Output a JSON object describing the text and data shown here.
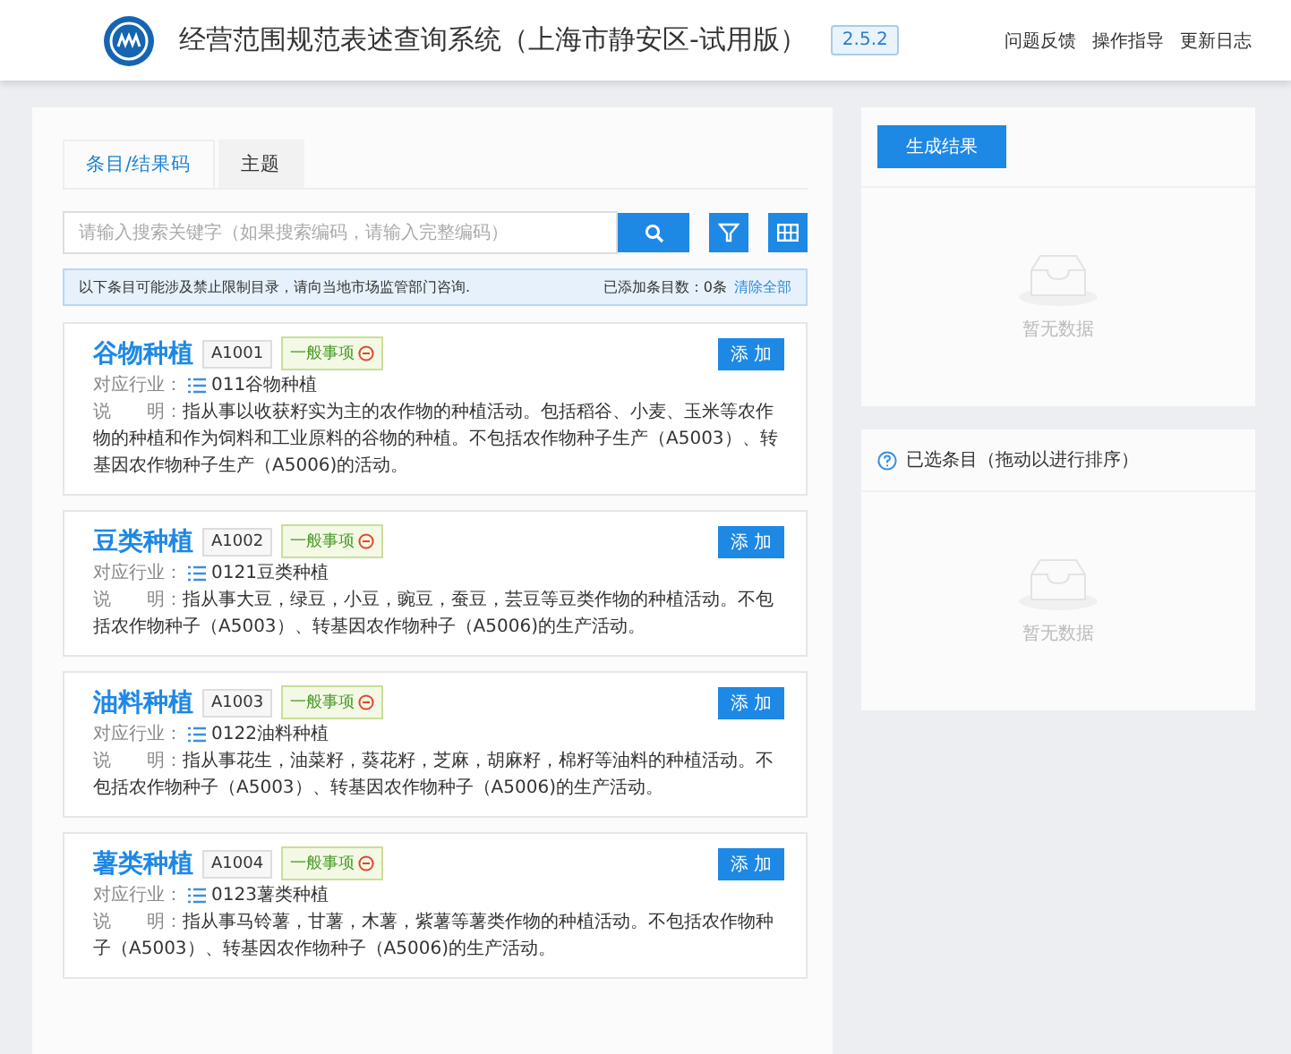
{
  "header": {
    "title": "经营范围规范表述查询系统（上海市静安区-试用版）",
    "version": "2.5.2",
    "links": [
      "问题反馈",
      "操作指导",
      "更新日志"
    ]
  },
  "tabs": [
    {
      "label": "条目/结果码",
      "selected": true
    },
    {
      "label": "主题",
      "selected": false
    }
  ],
  "search": {
    "placeholder": "请输入搜索关键字（如果搜索编码，请输入完整编码）"
  },
  "notice": {
    "text": "以下条目可能涉及禁止限制目录，请向当地市场监管部门咨询.",
    "count": "已添加条目数：0条",
    "clear": "清除全部"
  },
  "items": [
    {
      "name": "谷物种植",
      "code": "A1001",
      "tag": "一般事项",
      "industry_label": "对应行业：",
      "industry": "011谷物种植",
      "desc_label": "说　　明：",
      "desc": "指从事以收获籽实为主的农作物的种植活动。包括稻谷、小麦、玉米等农作物的种植和作为饲料和工业原料的谷物的种植。不包括农作物种子生产（A5003）、转基因农作物种子生产（A5006)的活动。",
      "button": "添 加"
    },
    {
      "name": "豆类种植",
      "code": "A1002",
      "tag": "一般事项",
      "industry_label": "对应行业：",
      "industry": "0121豆类种植",
      "desc_label": "说　　明：",
      "desc": "指从事大豆，绿豆，小豆，豌豆，蚕豆，芸豆等豆类作物的种植活动。不包括农作物种子（A5003）、转基因农作物种子（A5006)的生产活动。",
      "button": "添 加"
    },
    {
      "name": "油料种植",
      "code": "A1003",
      "tag": "一般事项",
      "industry_label": "对应行业：",
      "industry": "0122油料种植",
      "desc_label": "说　　明：",
      "desc": "指从事花生，油菜籽，葵花籽，芝麻，胡麻籽，棉籽等油料的种植活动。不包括农作物种子（A5003）、转基因农作物种子（A5006)的生产活动。",
      "button": "添 加"
    },
    {
      "name": "薯类种植",
      "code": "A1004",
      "tag": "一般事项",
      "industry_label": "对应行业：",
      "industry": "0123薯类种植",
      "desc_label": "说　　明：",
      "desc": "指从事马铃薯，甘薯，木薯，紫薯等薯类作物的种植活动。不包括农作物种子（A5003）、转基因农作物种子（A5006)的生产活动。",
      "button": "添 加"
    }
  ],
  "result_panel": {
    "button": "生成结果",
    "empty": "暂无数据"
  },
  "selected_panel": {
    "title": "已选条目（拖动以进行排序）",
    "empty": "暂无数据"
  }
}
